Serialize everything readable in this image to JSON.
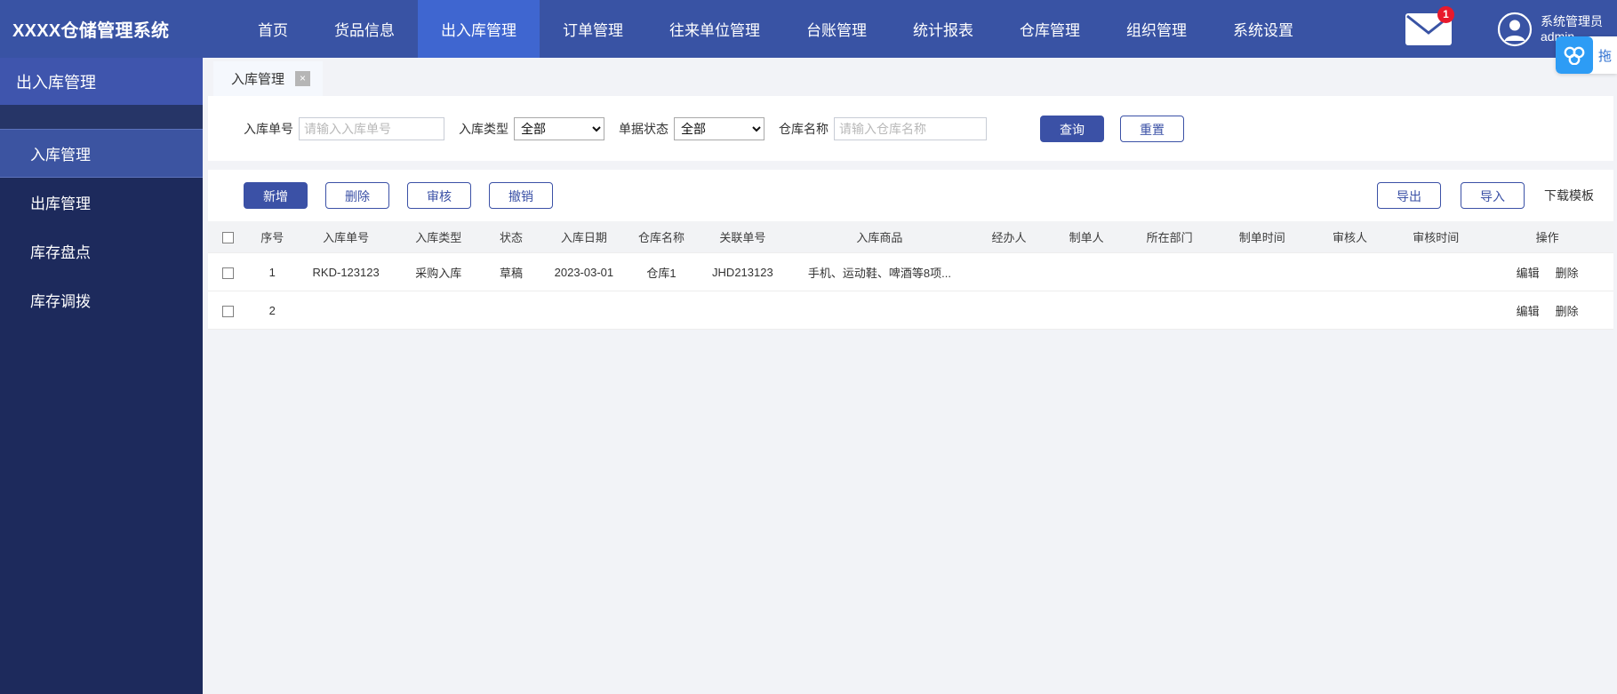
{
  "header": {
    "brand": "XXXX仓储管理系统",
    "nav": [
      {
        "label": "首页",
        "active": false
      },
      {
        "label": "货品信息",
        "active": false
      },
      {
        "label": "出入库管理",
        "active": true
      },
      {
        "label": "订单管理",
        "active": false
      },
      {
        "label": "往来单位管理",
        "active": false
      },
      {
        "label": "台账管理",
        "active": false
      },
      {
        "label": "统计报表",
        "active": false
      },
      {
        "label": "仓库管理",
        "active": false
      },
      {
        "label": "组织管理",
        "active": false
      },
      {
        "label": "系统设置",
        "active": false
      }
    ],
    "mail_icon": "mail-icon",
    "mail_badge": "1",
    "avatar_icon": "user-avatar-icon",
    "user_name": "系统管理员",
    "user_login": "admin"
  },
  "sidebar": {
    "title": "出入库管理",
    "items": [
      {
        "label": "入库管理",
        "active": true
      },
      {
        "label": "出库管理",
        "active": false
      },
      {
        "label": "库存盘点",
        "active": false
      },
      {
        "label": "库存调拨",
        "active": false
      }
    ]
  },
  "tabs": [
    {
      "label": "入库管理",
      "close_icon": "close-icon",
      "close_label": "×"
    }
  ],
  "filters": {
    "order_no": {
      "label": "入库单号",
      "value": "",
      "placeholder": "请输入入库单号"
    },
    "in_type": {
      "label": "入库类型",
      "value": "全部",
      "options": [
        "全部"
      ]
    },
    "doc_status": {
      "label": "单据状态",
      "value": "全部",
      "options": [
        "全部"
      ]
    },
    "warehouse": {
      "label": "仓库名称",
      "value": "",
      "placeholder": "请输入仓库名称"
    },
    "query_label": "查询",
    "reset_label": "重置"
  },
  "toolbar": {
    "add_label": "新增",
    "delete_label": "删除",
    "audit_label": "审核",
    "revoke_label": "撤销",
    "export_label": "导出",
    "import_label": "导入",
    "template_label": "下载模板"
  },
  "table": {
    "columns": [
      "序号",
      "入库单号",
      "入库类型",
      "状态",
      "入库日期",
      "仓库名称",
      "关联单号",
      "入库商品",
      "经办人",
      "制单人",
      "所在部门",
      "制单时间",
      "审核人",
      "审核时间",
      "操作"
    ],
    "rows": [
      {
        "index": "1",
        "order_no": "RKD-123123",
        "in_type": "采购入库",
        "status": "草稿",
        "in_date": "2023-03-01",
        "warehouse": "仓库1",
        "related_no": "JHD213123",
        "goods": "手机、运动鞋、啤酒等8项...",
        "handler": "",
        "creator": "",
        "department": "",
        "create_time": "",
        "auditor": "",
        "audit_time": "",
        "edit_label": "编辑",
        "delete_label": "删除"
      },
      {
        "index": "2",
        "order_no": "",
        "in_type": "",
        "status": "",
        "in_date": "",
        "warehouse": "",
        "related_no": "",
        "goods": "",
        "handler": "",
        "creator": "",
        "department": "",
        "create_time": "",
        "auditor": "",
        "audit_time": "",
        "edit_label": "编辑",
        "delete_label": "删除"
      }
    ]
  },
  "float_widget": {
    "icon": "cloud-link-icon",
    "label": "拖"
  },
  "colors": {
    "header_bg": "#3953a4",
    "nav_active": "#3f66d0",
    "sidebar_bg": "#1d2a5c",
    "sidebar_title_bg": "#3f55ad",
    "sidebar_active": "#3c54a1",
    "primary": "#3b51a6",
    "badge_red": "#e8192c",
    "content_bg": "#f2f3f7",
    "float_icon_bg": "#2d9cf5"
  }
}
